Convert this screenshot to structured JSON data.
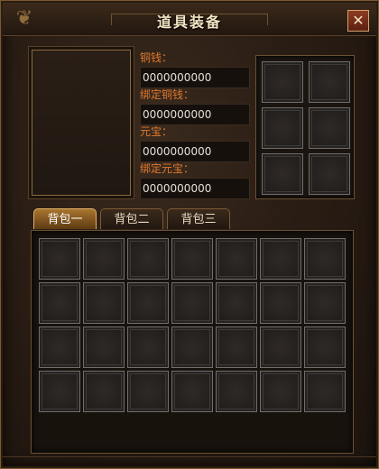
{
  "window": {
    "title": "道具装备",
    "close_label": "✕"
  },
  "stats": [
    {
      "label": "铜钱：",
      "value": "0000000000"
    },
    {
      "label": "绑定铜钱：",
      "value": "0000000000"
    },
    {
      "label": "元宝：",
      "value": "0000000000"
    },
    {
      "label": "绑定元宝：",
      "value": "0000000000"
    }
  ],
  "tabs": [
    {
      "label": "背包一",
      "active": true
    },
    {
      "label": "背包二",
      "active": false
    },
    {
      "label": "背包三",
      "active": false
    }
  ],
  "equip_slots": {
    "rows": 3,
    "cols": 2
  },
  "bag_slots": {
    "rows": 4,
    "cols": 7
  },
  "colors": {
    "accent": "#e07a2c",
    "frame": "#7a5a32"
  }
}
